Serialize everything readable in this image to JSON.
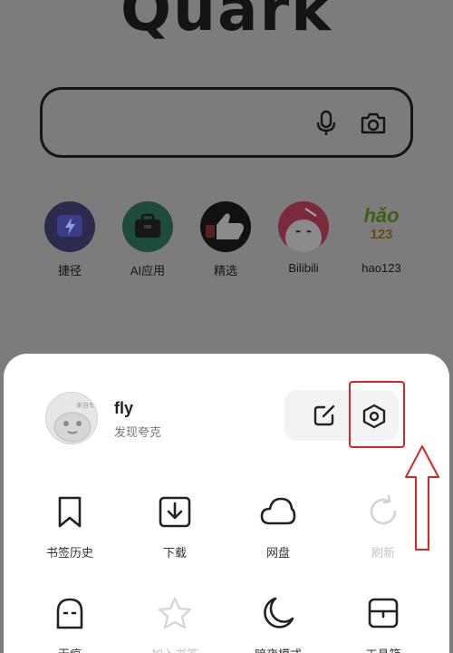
{
  "home": {
    "logo": "Quark",
    "shortcuts": [
      {
        "label": "捷径",
        "icon": "shortcut-icon"
      },
      {
        "label": "AI应用",
        "icon": "ai-apps-icon"
      },
      {
        "label": "精选",
        "icon": "featured-icon"
      },
      {
        "label": "Bilibili",
        "icon": "bilibili-icon"
      },
      {
        "label": "hao123",
        "icon": "hao123-icon",
        "logo_top": "hǎo",
        "logo_bottom": "123"
      }
    ]
  },
  "menu": {
    "user": {
      "name": "fly",
      "subtitle": "发现夸克",
      "avatar_badge": "来自夸克"
    },
    "row1": [
      {
        "label": "书签历史",
        "icon": "bookmark-icon",
        "enabled": true
      },
      {
        "label": "下载",
        "icon": "download-icon",
        "enabled": true
      },
      {
        "label": "网盘",
        "icon": "cloud-drive-icon",
        "enabled": true
      },
      {
        "label": "刷新",
        "icon": "refresh-icon",
        "enabled": false
      }
    ],
    "row2": [
      {
        "label": "无痕",
        "icon": "incognito-icon",
        "enabled": true
      },
      {
        "label": "加入书签",
        "icon": "star-icon",
        "enabled": false
      },
      {
        "label": "暗夜模式",
        "icon": "moon-icon",
        "enabled": true
      },
      {
        "label": "工具箱",
        "icon": "toolbox-icon",
        "enabled": true
      }
    ]
  },
  "colors": {
    "overlay": "#7c7c7c",
    "sheet": "#ffffff",
    "annotation": "#d8262a",
    "disabled": "#c4c4c4"
  }
}
